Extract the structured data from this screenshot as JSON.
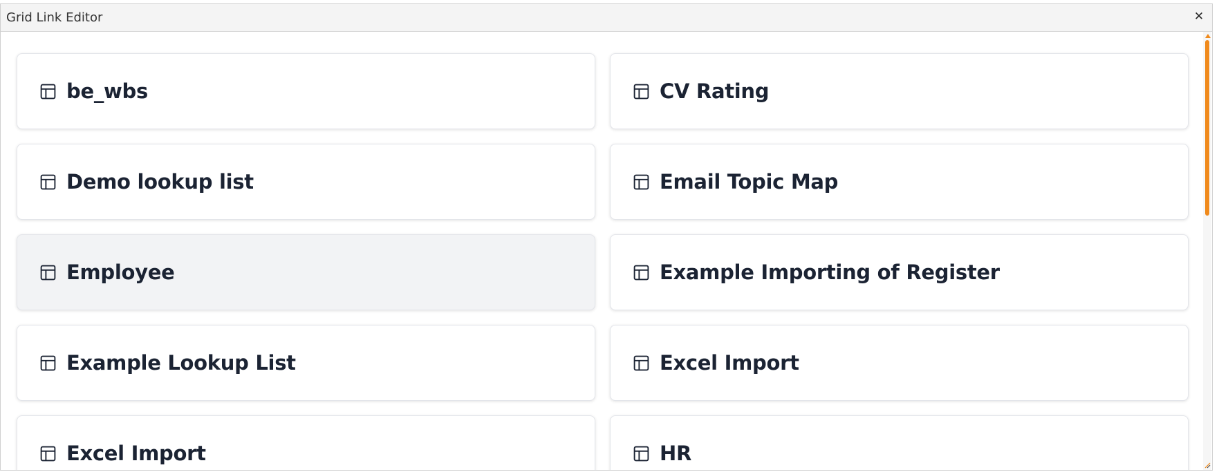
{
  "dialog": {
    "title": "Grid Link Editor",
    "close_glyph": "✕"
  },
  "cards": [
    {
      "label": "be_wbs",
      "icon": "table-icon"
    },
    {
      "label": "CV Rating",
      "icon": "table-icon"
    },
    {
      "label": "Demo lookup list",
      "icon": "table-icon"
    },
    {
      "label": "Email Topic Map",
      "icon": "table-icon"
    },
    {
      "label": "Employee",
      "icon": "table-icon",
      "state": "hover"
    },
    {
      "label": "Example Importing of Register",
      "icon": "table-icon"
    },
    {
      "label": "Example Lookup List",
      "icon": "table-icon"
    },
    {
      "label": "Excel Import",
      "icon": "table-icon"
    },
    {
      "label": "Excel Import",
      "icon": "table-icon"
    },
    {
      "label": "HR",
      "icon": "table-icon"
    }
  ],
  "colors": {
    "accent": "#f08a1c",
    "card_text": "#1b2333",
    "hover_bg": "#f2f3f5"
  }
}
